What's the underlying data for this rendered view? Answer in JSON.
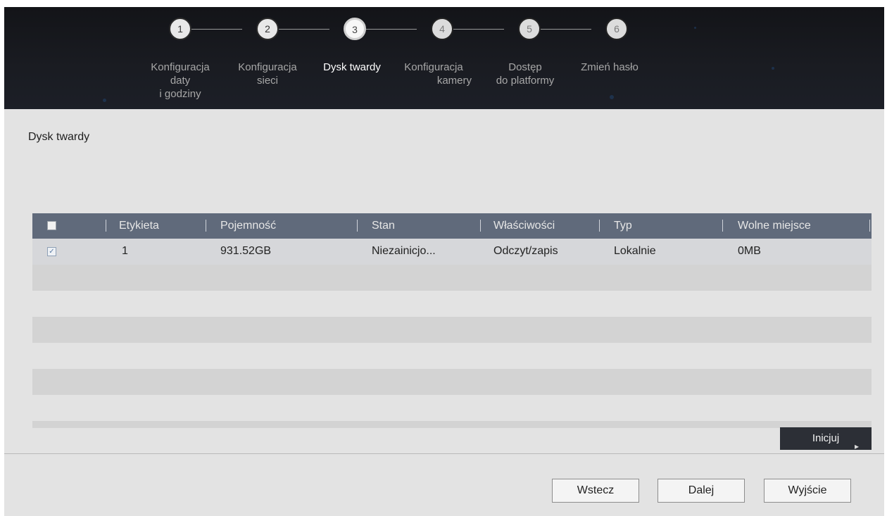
{
  "wizard": {
    "steps": [
      {
        "number": "1",
        "label_line1": "Konfiguracja",
        "label_line2": "daty",
        "label_line3": "i godziny"
      },
      {
        "number": "2",
        "label_line1": "Konfiguracja",
        "label_line2": "sieci",
        "label_line3": ""
      },
      {
        "number": "3",
        "label_line1": "Dysk twardy",
        "label_line2": "",
        "label_line3": ""
      },
      {
        "number": "4",
        "label_line1": "Konfiguracja",
        "label_line2": "kamery",
        "label_line3": ""
      },
      {
        "number": "5",
        "label_line1": "Dostęp",
        "label_line2": "do platformy",
        "label_line3": ""
      },
      {
        "number": "6",
        "label_line1": "Zmień hasło",
        "label_line2": "",
        "label_line3": ""
      }
    ],
    "active_step": 3
  },
  "page": {
    "title": "Dysk twardy"
  },
  "table": {
    "columns": [
      "Etykieta",
      "Pojemność",
      "Stan",
      "Właściwości",
      "Typ",
      "Wolne miejsce"
    ],
    "rows": [
      {
        "checked": true,
        "label": "1",
        "capacity": "931.52GB",
        "status": "Niezainicjo...",
        "property": "Odczyt/zapis",
        "type": "Lokalnie",
        "free": "0MB"
      }
    ]
  },
  "actions": {
    "init_label": "Inicjuj",
    "back_label": "Wstecz",
    "next_label": "Dalej",
    "exit_label": "Wyjście"
  },
  "colors": {
    "header_bg": "#16181d",
    "table_header_bg": "#606a7b",
    "init_button_bg": "#2c2f36",
    "page_bg": "#e3e3e3"
  }
}
